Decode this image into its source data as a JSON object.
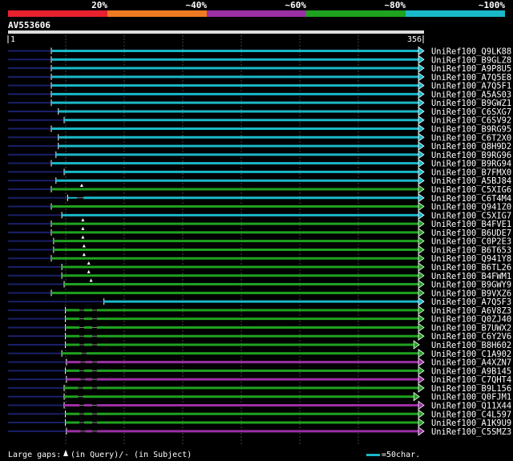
{
  "legend": {
    "segments": [
      {
        "label": "20%",
        "color": "#e8212f"
      },
      {
        "label": "~40%",
        "color": "#ee7a22"
      },
      {
        "label": "~60%",
        "color": "#9b2fa4"
      },
      {
        "label": "~80%",
        "color": "#1fa21f"
      },
      {
        "label": "~100%",
        "color": "#1ab8c8"
      }
    ]
  },
  "query": {
    "id": "AV553606",
    "start": "1",
    "end": "356"
  },
  "footer": {
    "gaps_prefix": "Large gaps: ",
    "gaps_query": "(in Query)/",
    "gaps_dash": "-",
    "gaps_subject": " (in Subject)",
    "scale_label": "=50char."
  },
  "colors": {
    "background": "#000000",
    "grid": "#444444",
    "query_line": "#dddddd",
    "unaligned": "#1a1f6a",
    "text": "#ffffff"
  },
  "hits": [
    {
      "label": "UniRef100_Q9LK88",
      "color": "cyan",
      "start": 38,
      "end": 356
    },
    {
      "label": "UniRef100_B9GLZ8",
      "color": "cyan",
      "start": 38,
      "end": 356
    },
    {
      "label": "UniRef100_A9P8U5",
      "color": "cyan",
      "start": 38,
      "end": 356
    },
    {
      "label": "UniRef100_A7Q5E8",
      "color": "cyan",
      "start": 38,
      "end": 356
    },
    {
      "label": "UniRef100_A7Q5F1",
      "color": "cyan",
      "start": 38,
      "end": 356
    },
    {
      "label": "UniRef100_A5AS03",
      "color": "cyan",
      "start": 38,
      "end": 356
    },
    {
      "label": "UniRef100_B9GWZ1",
      "color": "cyan",
      "start": 38,
      "end": 356
    },
    {
      "label": "UniRef100_C6SXG7",
      "color": "cyan",
      "start": 44,
      "end": 356
    },
    {
      "label": "UniRef100_C6SV92",
      "color": "cyan",
      "start": 49,
      "end": 356
    },
    {
      "label": "UniRef100_B9RG95",
      "color": "cyan",
      "start": 38,
      "end": 356
    },
    {
      "label": "UniRef100_C6T2X0",
      "color": "cyan",
      "start": 44,
      "end": 356
    },
    {
      "label": "UniRef100_Q8H9D2",
      "color": "cyan",
      "start": 44,
      "end": 356
    },
    {
      "label": "UniRef100_B9RG96",
      "color": "cyan",
      "start": 42,
      "end": 356
    },
    {
      "label": "UniRef100_B9RG94",
      "color": "cyan",
      "start": 38,
      "end": 356
    },
    {
      "label": "UniRef100_B7FMX0",
      "color": "cyan",
      "start": 49,
      "end": 356
    },
    {
      "label": "UniRef100_A5BJ84",
      "color": "cyan",
      "start": 42,
      "end": 356
    },
    {
      "label": "UniRef100_C5XIG6",
      "color": "green",
      "start": 38,
      "end": 356,
      "qgap": 64
    },
    {
      "label": "UniRef100_C6T4M4",
      "color": "cyan",
      "start": 52,
      "end": 356,
      "seg2": 60
    },
    {
      "label": "UniRef100_Q941Z0",
      "color": "green",
      "start": 38,
      "end": 356
    },
    {
      "label": "UniRef100_C5XIG7",
      "color": "cyan",
      "start": 47,
      "end": 356
    },
    {
      "label": "UniRef100_B4FVE1",
      "color": "green",
      "start": 38,
      "end": 356,
      "qgap": 65
    },
    {
      "label": "UniRef100_B6UDE7",
      "color": "green",
      "start": 38,
      "end": 356,
      "qgap": 65
    },
    {
      "label": "UniRef100_C0P2E3",
      "color": "green",
      "start": 40,
      "end": 356,
      "qgap": 65
    },
    {
      "label": "UniRef100_B6T653",
      "color": "green",
      "start": 40,
      "end": 356,
      "qgap": 66
    },
    {
      "label": "UniRef100_Q941Y8",
      "color": "green",
      "start": 38,
      "end": 356,
      "qgap": 66
    },
    {
      "label": "UniRef100_B6TL26",
      "color": "green",
      "start": 47,
      "end": 356,
      "qgap": 70
    },
    {
      "label": "UniRef100_B4FWM1",
      "color": "green",
      "start": 47,
      "end": 356,
      "qgap": 70
    },
    {
      "label": "UniRef100_B9GWY9",
      "color": "green",
      "start": 49,
      "end": 356,
      "qgap": 72
    },
    {
      "label": "UniRef100_B9VXZ6",
      "color": "green",
      "start": 38,
      "end": 356
    },
    {
      "label": "UniRef100_A7Q5F3",
      "color": "cyan",
      "start": 83,
      "end": 356
    },
    {
      "label": "UniRef100_A6V8Z3",
      "color": "green",
      "start": 50,
      "end": 356,
      "sgaps": [
        62,
        73
      ]
    },
    {
      "label": "UniRef100_Q0ZJ40",
      "color": "green",
      "start": 50,
      "end": 356,
      "sgaps": [
        62,
        73
      ]
    },
    {
      "label": "UniRef100_B7UWX2",
      "color": "green",
      "start": 50,
      "end": 356,
      "sgaps": [
        62,
        73
      ]
    },
    {
      "label": "UniRef100_C6Y2V6",
      "color": "green",
      "start": 50,
      "end": 356,
      "sgaps": [
        62,
        73
      ]
    },
    {
      "label": "UniRef100_B8H602",
      "color": "green",
      "start": 50,
      "end": 352,
      "sgaps": [
        62,
        73
      ]
    },
    {
      "label": "UniRef100_C1A902",
      "color": "green",
      "start": 47,
      "end": 356,
      "sgaps": [
        64
      ]
    },
    {
      "label": "UniRef100_A4XZN7",
      "color": "purple",
      "start": 51,
      "end": 356,
      "sgaps": [
        63,
        73
      ]
    },
    {
      "label": "UniRef100_A9B145",
      "color": "green",
      "start": 50,
      "end": 356,
      "sgaps": [
        62,
        73
      ]
    },
    {
      "label": "UniRef100_C7QHT4",
      "color": "purple",
      "start": 51,
      "end": 356,
      "sgaps": [
        63,
        73
      ]
    },
    {
      "label": "UniRef100_B9L156",
      "color": "green",
      "start": 49,
      "end": 356,
      "sgaps": [
        61,
        73
      ]
    },
    {
      "label": "UniRef100_Q0FJM1",
      "color": "green",
      "start": 49,
      "end": 352,
      "sgaps": [
        61
      ]
    },
    {
      "label": "UniRef100_Q11X44",
      "color": "purple",
      "start": 49,
      "end": 356,
      "sgaps": [
        62,
        73
      ]
    },
    {
      "label": "UniRef100_C4L597",
      "color": "green",
      "start": 50,
      "end": 356,
      "sgaps": [
        62,
        73
      ]
    },
    {
      "label": "UniRef100_A1K9U9",
      "color": "green",
      "start": 50,
      "end": 356,
      "sgaps": [
        62,
        73
      ]
    },
    {
      "label": "UniRef100_C5SMZ3",
      "color": "purple",
      "start": 51,
      "end": 356,
      "sgaps": [
        63,
        73
      ]
    }
  ]
}
